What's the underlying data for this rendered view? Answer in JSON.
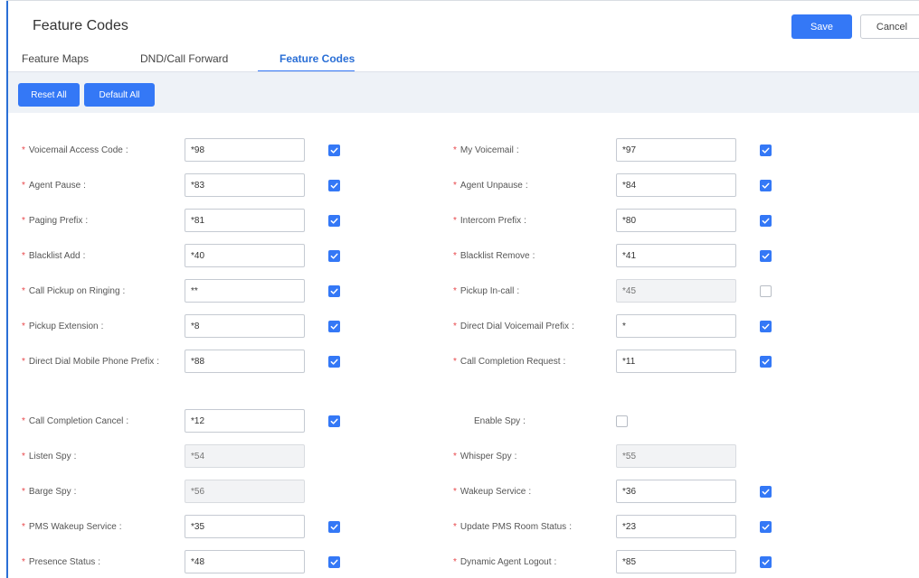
{
  "page": {
    "title": "Feature Codes",
    "save_label": "Save",
    "cancel_label": "Cancel"
  },
  "tabs": [
    {
      "label": "Feature Maps",
      "active": false
    },
    {
      "label": "DND/Call Forward",
      "active": false
    },
    {
      "label": "Feature Codes",
      "active": true
    }
  ],
  "toolbar": {
    "reset_all_label": "Reset All",
    "default_all_label": "Default All"
  },
  "colors": {
    "accent": "#3478f6",
    "required": "#e8464a"
  },
  "rows": [
    {
      "left": {
        "label": "Voicemail Access Code",
        "required": true,
        "value": "*98",
        "disabled": false,
        "checked": true
      },
      "right": {
        "label": "My Voicemail",
        "required": true,
        "value": "*97",
        "disabled": false,
        "checked": true
      }
    },
    {
      "left": {
        "label": "Agent Pause",
        "required": true,
        "value": "*83",
        "disabled": false,
        "checked": true
      },
      "right": {
        "label": "Agent Unpause",
        "required": true,
        "value": "*84",
        "disabled": false,
        "checked": true
      }
    },
    {
      "left": {
        "label": "Paging Prefix",
        "required": true,
        "value": "*81",
        "disabled": false,
        "checked": true
      },
      "right": {
        "label": "Intercom Prefix",
        "required": true,
        "value": "*80",
        "disabled": false,
        "checked": true
      }
    },
    {
      "left": {
        "label": "Blacklist Add",
        "required": true,
        "value": "*40",
        "disabled": false,
        "checked": true
      },
      "right": {
        "label": "Blacklist Remove",
        "required": true,
        "value": "*41",
        "disabled": false,
        "checked": true
      }
    },
    {
      "left": {
        "label": "Call Pickup on Ringing",
        "required": true,
        "value": "**",
        "disabled": false,
        "checked": true
      },
      "right": {
        "label": "Pickup In-call",
        "required": true,
        "value": "*45",
        "disabled": true,
        "checked": false
      }
    },
    {
      "left": {
        "label": "Pickup Extension",
        "required": true,
        "value": "*8",
        "disabled": false,
        "checked": true
      },
      "right": {
        "label": "Direct Dial Voicemail Prefix",
        "required": true,
        "value": "*",
        "disabled": false,
        "checked": true
      }
    },
    {
      "left": {
        "label": "Direct Dial Mobile Phone Prefix",
        "required": true,
        "value": "*88",
        "disabled": false,
        "checked": true
      },
      "right": {
        "label": "Call Completion Request",
        "required": true,
        "value": "*11",
        "disabled": false,
        "checked": true
      }
    },
    {
      "left": {
        "label": "Call Completion Cancel",
        "required": true,
        "value": "*12",
        "disabled": false,
        "checked": true
      },
      "right": {
        "label": "Enable Spy",
        "required": false,
        "value": null,
        "disabled": false,
        "checked": false
      }
    },
    {
      "left": {
        "label": "Listen Spy",
        "required": true,
        "value": "*54",
        "disabled": true,
        "checked": null
      },
      "right": {
        "label": "Whisper Spy",
        "required": true,
        "value": "*55",
        "disabled": true,
        "checked": null
      }
    },
    {
      "left": {
        "label": "Barge Spy",
        "required": true,
        "value": "*56",
        "disabled": true,
        "checked": null
      },
      "right": {
        "label": "Wakeup Service",
        "required": true,
        "value": "*36",
        "disabled": false,
        "checked": true
      }
    },
    {
      "left": {
        "label": "PMS Wakeup Service",
        "required": true,
        "value": "*35",
        "disabled": false,
        "checked": true
      },
      "right": {
        "label": "Update PMS Room Status",
        "required": true,
        "value": "*23",
        "disabled": false,
        "checked": true
      }
    },
    {
      "left": {
        "label": "Presence Status",
        "required": true,
        "value": "*48",
        "disabled": false,
        "checked": true
      },
      "right": {
        "label": "Dynamic Agent Logout",
        "required": true,
        "value": "*85",
        "disabled": false,
        "checked": true
      }
    }
  ]
}
